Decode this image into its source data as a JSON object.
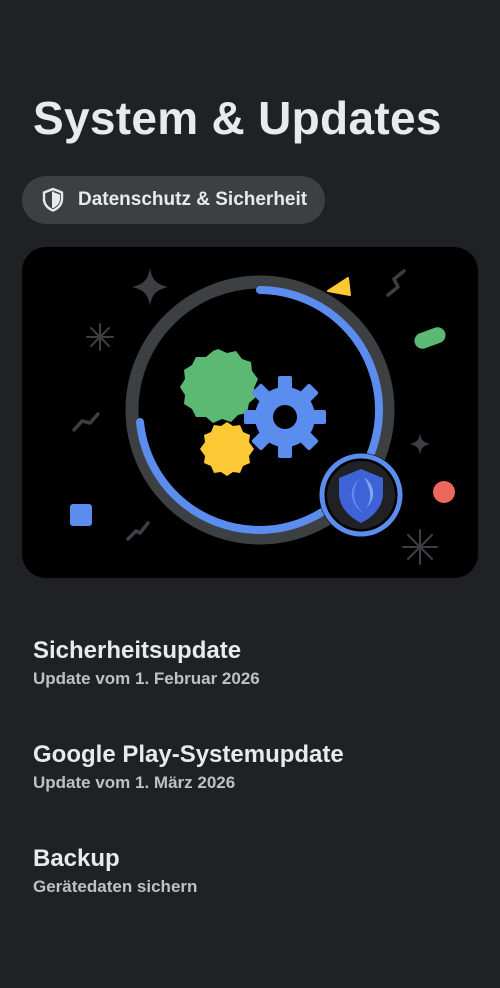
{
  "page": {
    "title": "System & Updates"
  },
  "chip": {
    "label": "Datenschutz & Sicherheit",
    "icon": "shield-icon"
  },
  "illustration": {
    "icons": [
      "gear-icon",
      "shield-icon",
      "sparkle-icon",
      "triangle-icon",
      "square-icon"
    ],
    "colors": {
      "blue": "#5b8def",
      "green": "#5bb974",
      "yellow": "#fcc934",
      "red": "#ee675c",
      "ring": "#3c4043"
    }
  },
  "items": [
    {
      "title": "Sicherheitsupdate",
      "subtitle": "Update vom 1. Februar 2026"
    },
    {
      "title": "Google Play-Systemupdate",
      "subtitle": "Update vom 1. März 2026"
    },
    {
      "title": "Backup",
      "subtitle": "Gerätedaten sichern"
    }
  ]
}
